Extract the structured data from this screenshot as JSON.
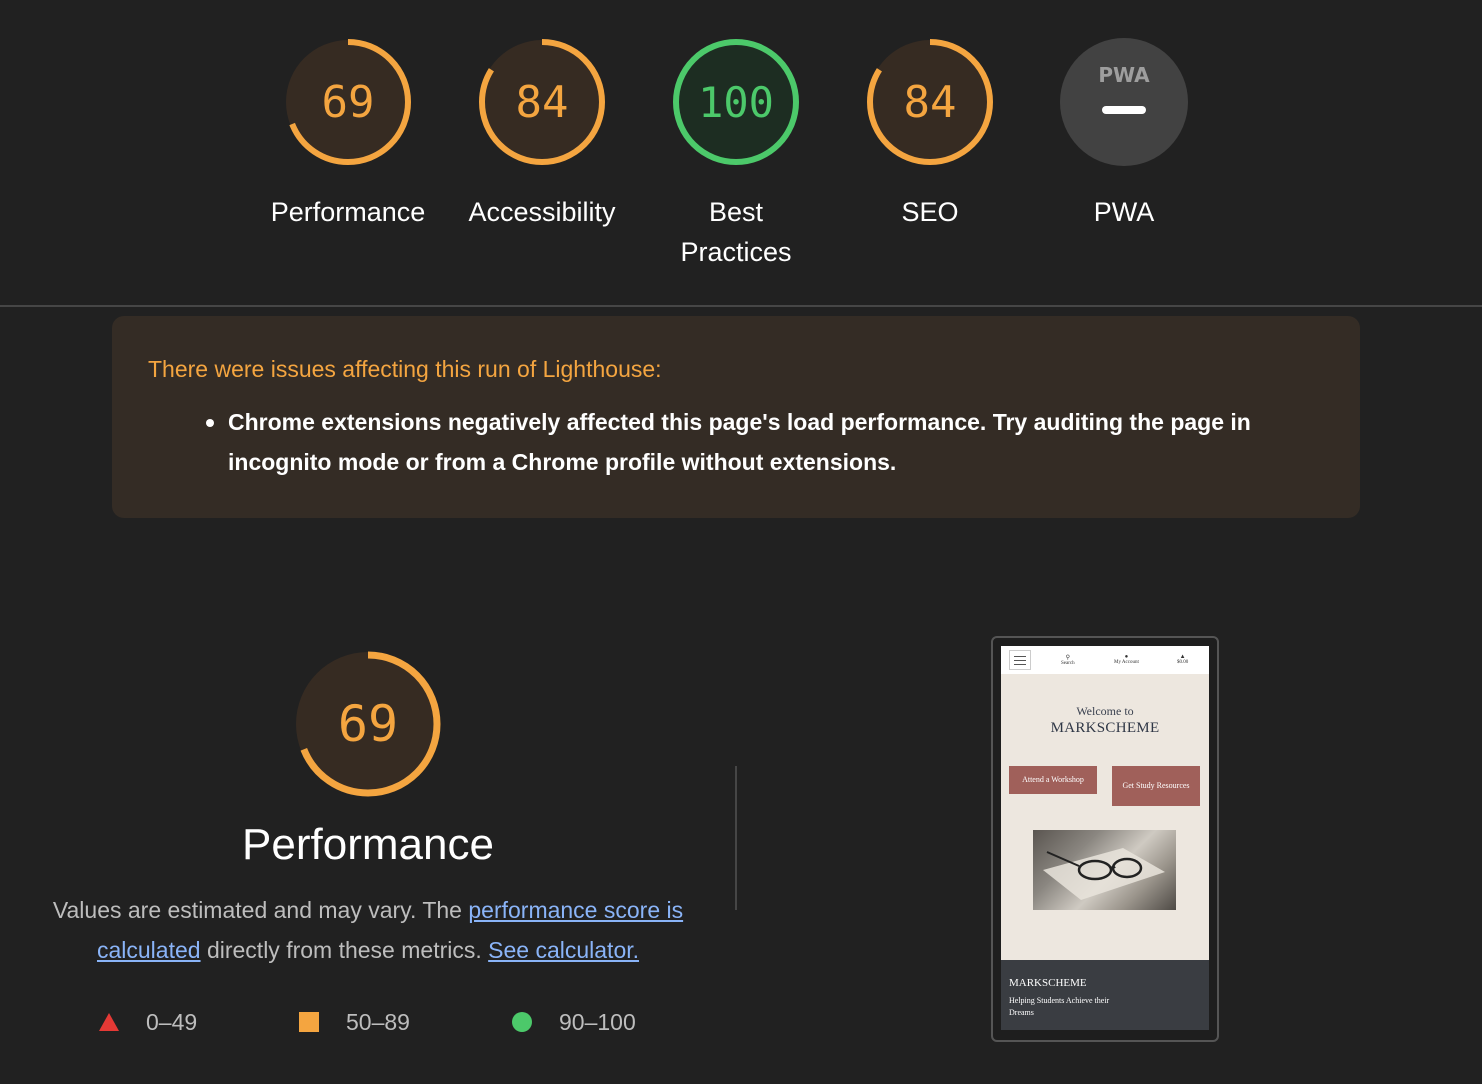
{
  "gauges": [
    {
      "score": "69",
      "label": "Performance",
      "value": 69,
      "status": "average"
    },
    {
      "score": "84",
      "label": "Accessibility",
      "value": 84,
      "status": "average"
    },
    {
      "score": "100",
      "label": "Best\nPractices",
      "value": 100,
      "status": "pass"
    },
    {
      "score": "84",
      "label": "SEO",
      "value": 84,
      "status": "average"
    },
    {
      "badge": "PWA",
      "label": "PWA",
      "status": "na"
    }
  ],
  "colors": {
    "average": "#f4a540",
    "average_bg": "#362b22",
    "pass": "#4cc96a",
    "pass_bg": "#1d2d22",
    "na_bg": "#424242",
    "fail": "#e53935",
    "link": "#8ab4f8"
  },
  "warning": {
    "title": "There were issues affecting this run of Lighthouse:",
    "items": [
      "Chrome extensions negatively affected this page's load performance. Try auditing the page in incognito mode or from a Chrome profile without extensions."
    ]
  },
  "performance": {
    "score": "69",
    "value": 69,
    "title": "Performance",
    "desc_prefix": "Values are estimated and may vary. The ",
    "link1": "performance score is calculated",
    "desc_middle": " directly from these metrics. ",
    "link2": "See calculator."
  },
  "legend": [
    {
      "shape": "triangle",
      "range": "0–49"
    },
    {
      "shape": "square",
      "range": "50–89"
    },
    {
      "shape": "circle",
      "range": "90–100"
    }
  ],
  "screenshot": {
    "nav": [
      "Search",
      "My Account",
      "$0.00"
    ],
    "welcome": "Welcome to",
    "brand": "MARKSCHEME",
    "button1": "Attend a Workshop",
    "button2": "Get Study Resources",
    "footer_brand": "MARKSCHEME",
    "footer_tagline": "Helping Students Achieve their Dreams"
  }
}
